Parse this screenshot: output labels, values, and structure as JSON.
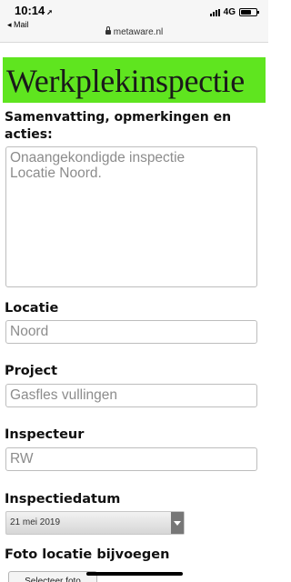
{
  "status_bar": {
    "time": "10:14",
    "back_label": "◂ Mail",
    "url": "metaware.nl",
    "network": "4G"
  },
  "header": {
    "title": "Werkplekinspectie",
    "color": "#5fe51f"
  },
  "form": {
    "summary_label_line1": "Samenvatting, opmerkingen en",
    "summary_label_line2": "acties:",
    "summary_placeholder": "Onaangekondigde inspectie\nLocatie Noord.",
    "location_label": "Locatie",
    "location_placeholder": "Noord",
    "project_label": "Project",
    "project_placeholder": "Gasfles vullingen",
    "inspector_label": "Inspecteur",
    "inspector_placeholder": "RW",
    "date_label": "Inspectiedatum",
    "date_value": "21 mei 2019",
    "photo_label": "Foto locatie bijvoegen",
    "photo_button": "Selecteer foto"
  }
}
